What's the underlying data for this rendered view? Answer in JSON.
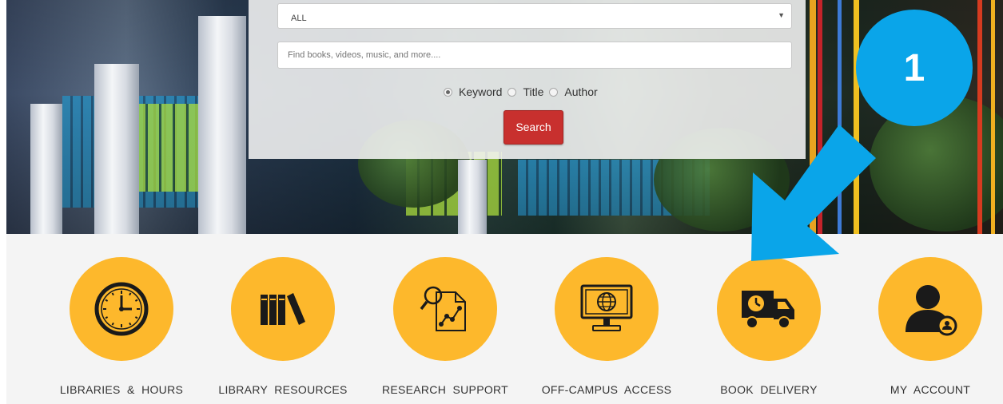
{
  "search": {
    "scope_selected": "ALL",
    "placeholder": "Find books, videos, music, and more....",
    "radio_options": [
      {
        "label": "Keyword",
        "checked": true
      },
      {
        "label": "Title",
        "checked": false
      },
      {
        "label": "Author",
        "checked": false
      }
    ],
    "button_label": "Search"
  },
  "services": [
    {
      "label": "LIBRARIES  &  HOURS",
      "icon": "clock-icon"
    },
    {
      "label": "LIBRARY  RESOURCES",
      "icon": "books-icon"
    },
    {
      "label": "RESEARCH  SUPPORT",
      "icon": "research-document-icon"
    },
    {
      "label": "OFF-CAMPUS  ACCESS",
      "icon": "globe-monitor-icon"
    },
    {
      "label": "BOOK  DELIVERY",
      "icon": "delivery-truck-icon"
    },
    {
      "label": "MY  ACCOUNT",
      "icon": "user-account-icon"
    }
  ],
  "callout": {
    "number": "1",
    "icon": "arrow-pointer-icon"
  },
  "colors": {
    "tile_circle": "#fdb82c",
    "search_button": "#c8302e",
    "callout": "#0aa5e9",
    "band": "#f4f4f4"
  }
}
